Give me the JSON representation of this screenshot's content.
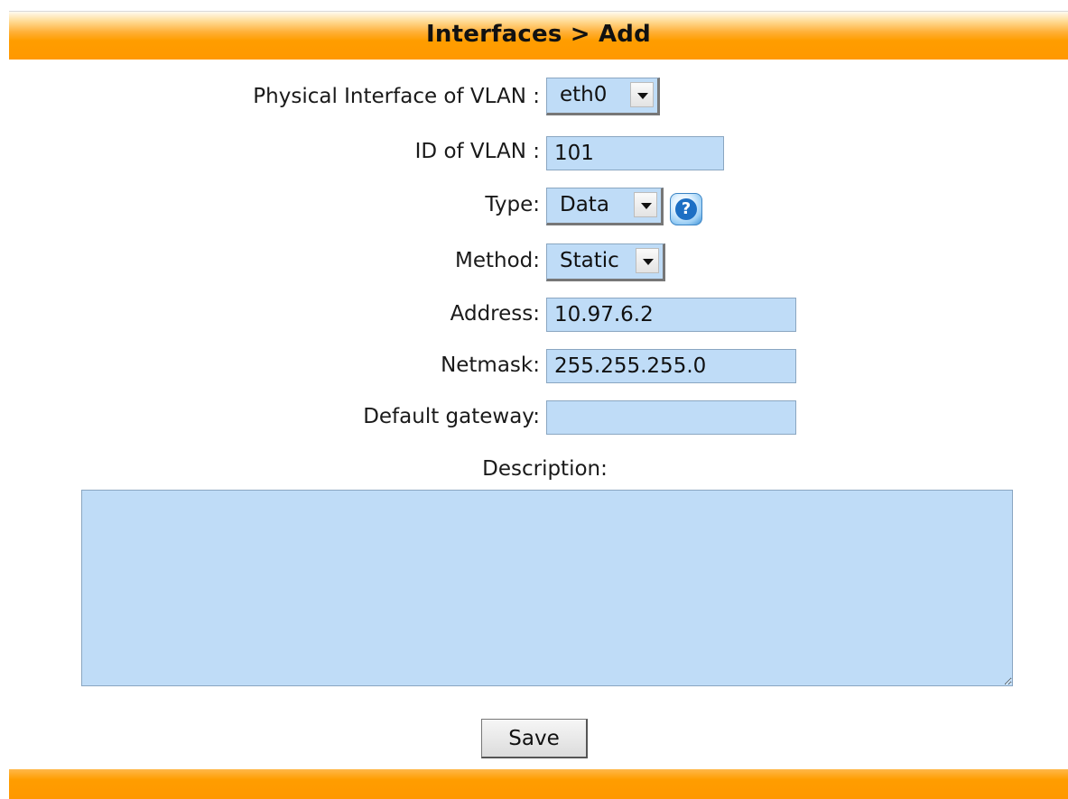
{
  "header": {
    "title": "Interfaces > Add"
  },
  "form": {
    "physical_interface": {
      "label": "Physical Interface of VLAN :",
      "value": "eth0"
    },
    "vlan_id": {
      "label": "ID of VLAN :",
      "value": "101"
    },
    "type": {
      "label": "Type:",
      "value": "Data",
      "help_icon": "question-help-icon"
    },
    "method": {
      "label": "Method:",
      "value": "Static"
    },
    "address": {
      "label": "Address:",
      "value": "10.97.6.2"
    },
    "netmask": {
      "label": "Netmask:",
      "value": "255.255.255.0"
    },
    "gateway": {
      "label": "Default gateway:",
      "value": ""
    },
    "description": {
      "label": "Description:",
      "value": ""
    }
  },
  "actions": {
    "save_label": "Save"
  },
  "colors": {
    "accent_orange": "#ff9800",
    "field_background": "#bfdcf7",
    "field_border": "#8aa6c1"
  }
}
